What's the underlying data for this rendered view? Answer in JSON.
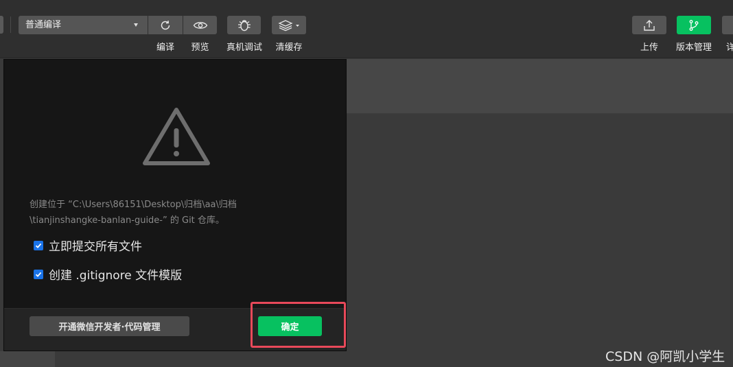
{
  "toolbar": {
    "mode_select": "普通编译",
    "compile_label": "编译",
    "preview_label": "预览",
    "debug_label": "真机调试",
    "cache_label": "清缓存",
    "upload_label": "上传",
    "version_label": "版本管理",
    "more_label_partial": "详",
    "version_color": "#07c160"
  },
  "dialog": {
    "message_line1": "创建位于 “C:\\Users\\86151\\Desktop\\归档\\aa\\归档",
    "message_line2": "\\tianjinshangke-banlan-guide-” 的 Git 仓库。",
    "option_commit": "立即提交所有文件",
    "option_gitignore": "创建 .gitignore 文件模版",
    "option_commit_checked": true,
    "option_gitignore_checked": true,
    "open_wechat_button": "开通微信开发者·代码管理",
    "confirm_button": "确定",
    "confirm_color": "#07c160"
  },
  "annotation": {
    "highlight_color": "#e8495a"
  },
  "watermark": "CSDN @阿凯小学生"
}
